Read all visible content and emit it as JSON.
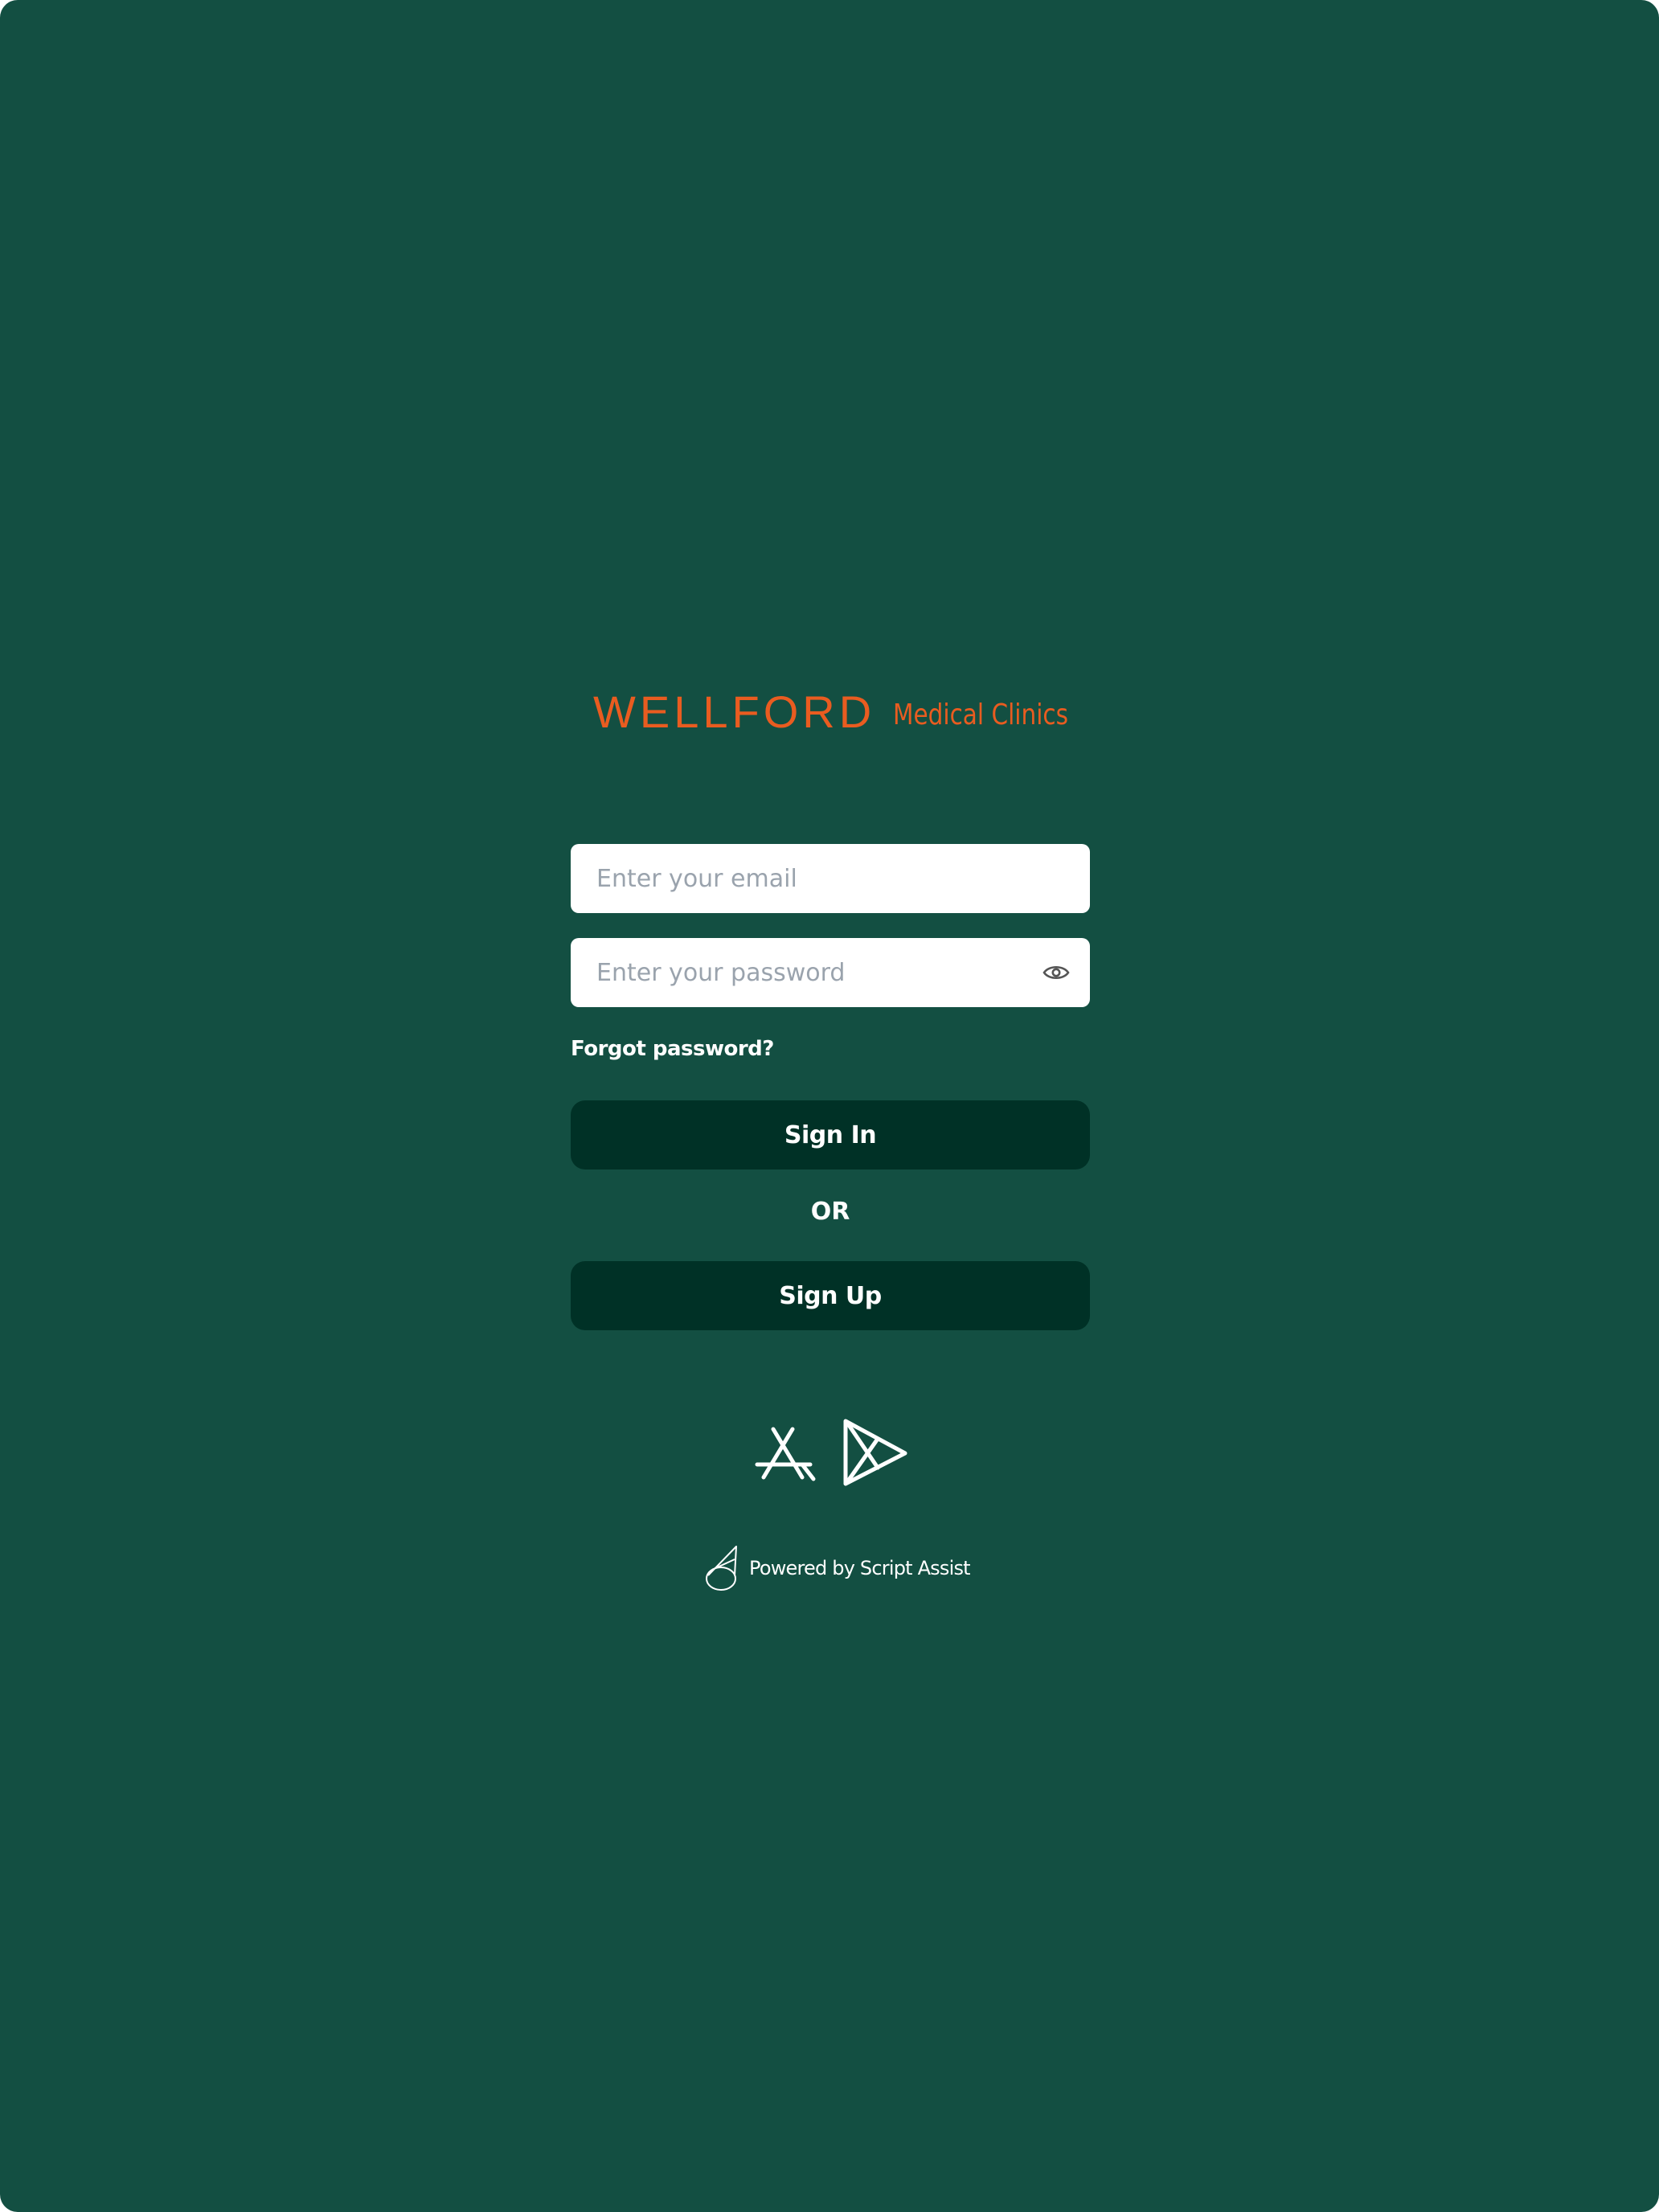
{
  "brand": {
    "name": "WELLFORD",
    "subtitle": "Medical Clinics",
    "color": "#e95c20"
  },
  "colors": {
    "background": "#134f42",
    "button": "#003126",
    "field": "#ffffff",
    "placeholder": "#9aa3ad"
  },
  "login": {
    "email_placeholder": "Enter your email",
    "password_placeholder": "Enter your password",
    "password_toggle_icon": "eye-icon",
    "forgot_password": "Forgot password?",
    "sign_in": "Sign In",
    "separator": "OR",
    "sign_up": "Sign Up"
  },
  "stores": {
    "app_store_icon": "app-store-icon",
    "play_store_icon": "google-play-icon"
  },
  "footer": {
    "powered_by": "Powered by Script Assist",
    "icon": "script-assist-logo-icon"
  }
}
